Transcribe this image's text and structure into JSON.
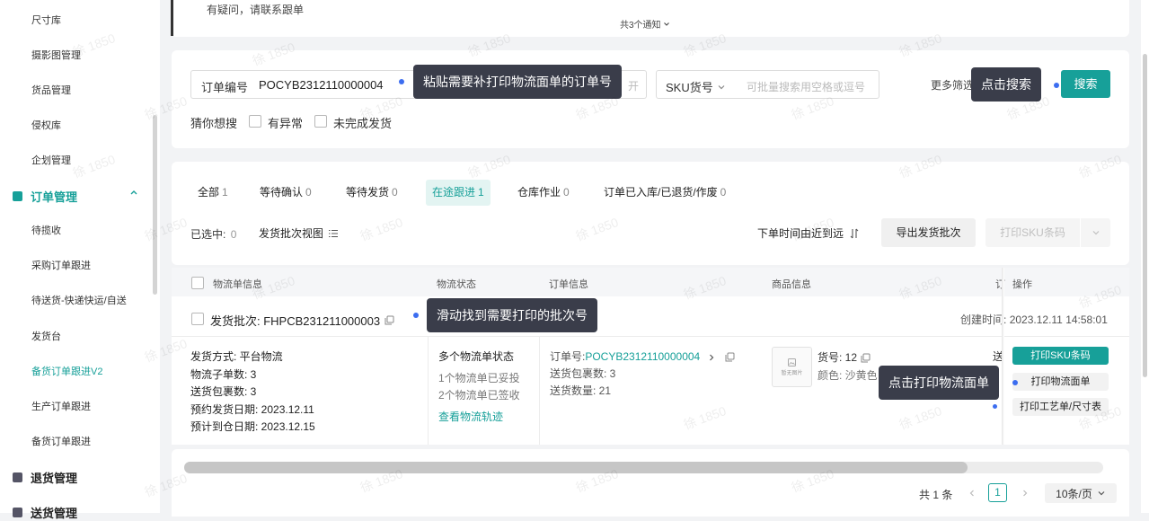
{
  "sidebar": {
    "items": [
      {
        "label": "尺寸库"
      },
      {
        "label": "摄影图管理"
      },
      {
        "label": "货品管理"
      },
      {
        "label": "侵权库"
      },
      {
        "label": "企划管理"
      }
    ],
    "order_group": {
      "label": "订单管理",
      "icon": "chevron-up-icon",
      "color": "#17a099"
    },
    "order_items": [
      {
        "label": "待揽收"
      },
      {
        "label": "采购订单跟进"
      },
      {
        "label": "待送货-快递快运/自送"
      },
      {
        "label": "发货台"
      },
      {
        "label": "备货订单跟进V2",
        "active": true
      },
      {
        "label": "生产订单跟进"
      },
      {
        "label": "备货订单跟进"
      }
    ],
    "return_group": {
      "label": "退货管理"
    },
    "delivery_group": {
      "label": "送货管理"
    }
  },
  "notice": {
    "text": "有疑问，请联系跟单",
    "more": "共3个通知"
  },
  "search": {
    "order_no_label": "订单编号",
    "order_no_value": "POCYB2312110000004",
    "order_no_partial": "开",
    "sku_select": "SKU货号",
    "sku_placeholder": "可批量搜索用空格或逗号",
    "more_filters": "更多筛选",
    "search_button": "搜索",
    "guess_label": "猜你想搜",
    "opt_abnormal": "有异常",
    "opt_unfinished": "未完成发货"
  },
  "callouts": {
    "paste": "粘贴需要补打印物流面单的订单号",
    "click_search": "点击搜索",
    "scroll_find": "滑动找到需要打印的批次号",
    "click_print": "点击打印物流面单"
  },
  "tabs": [
    {
      "label": "全部",
      "count": "1"
    },
    {
      "label": "等待确认",
      "count": "0"
    },
    {
      "label": "等待发货",
      "count": "0"
    },
    {
      "label": "在途跟进",
      "count": "1",
      "active": true
    },
    {
      "label": "仓库作业",
      "count": "0"
    },
    {
      "label": "订单已入库/已退货/作废",
      "count": "0"
    }
  ],
  "toolbar": {
    "selected_label": "已选中:",
    "selected_count": "0",
    "batch_view": "发货批次视图",
    "sort": "下单时间由近到远",
    "export_btn": "导出发货批次",
    "print_sku_btn": "打印SKU条码"
  },
  "table": {
    "headers": [
      "物流单信息",
      "物流状态",
      "订单信息",
      "商品信息",
      "订",
      "操作"
    ],
    "batch": {
      "label": "发货批次: FHPCB231211000003",
      "created_label": "创建时间:",
      "created_value": "2023.12.11 14:58:01"
    },
    "logistics_info": [
      "发货方式: 平台物流",
      "物流子单数: 3",
      "送货包裹数: 3",
      "预约发货日期: 2023.12.11",
      "预计到仓日期: 2023.12.15"
    ],
    "logistics_status": {
      "title": "多个物流单状态",
      "lines": [
        "1个物流单已妥投",
        "2个物流单已签收"
      ],
      "link": "查看物流轨迹"
    },
    "order_info": {
      "order_label": "订单号:",
      "order_no": "POCYB2312110000004",
      "lines": [
        "送货包裹数: 3",
        "送货数量: 21"
      ]
    },
    "product": {
      "placeholder": "暂无图片",
      "sku": "货号: 12",
      "color": "颜色: 沙黄色"
    },
    "partial_col": "送",
    "actions": {
      "print_sku": "打印SKU条码",
      "print_logistics": "打印物流面单",
      "print_craft": "打印工艺单/尺寸表"
    }
  },
  "pagination": {
    "total": "共 1 条",
    "current": "1",
    "page_size": "10条/页"
  },
  "watermark": "徐 1850",
  "colors": {
    "accent": "#17a099",
    "callout": "#3a3d4a",
    "marker": "#3c6df0"
  }
}
